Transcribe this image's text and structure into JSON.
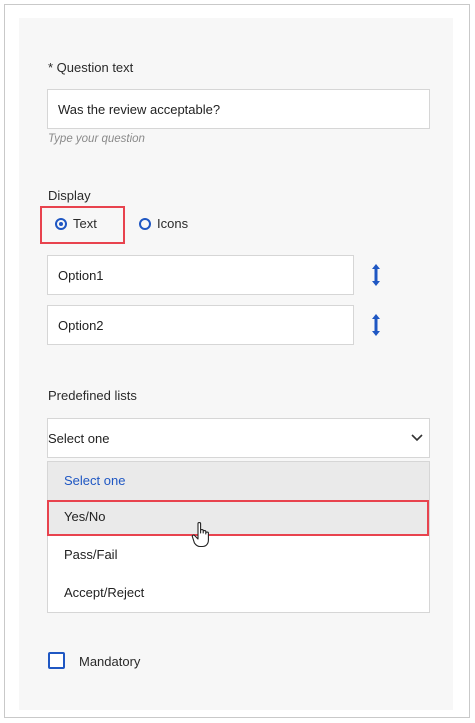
{
  "question": {
    "label": "* Question text",
    "value": "Was the review acceptable?",
    "hint": "Type your question"
  },
  "display": {
    "label": "Display",
    "options": [
      {
        "label": "Text",
        "selected": true
      },
      {
        "label": "Icons",
        "selected": false
      }
    ]
  },
  "options": [
    {
      "value": "Option1"
    },
    {
      "value": "Option2"
    }
  ],
  "predefined": {
    "label": "Predefined lists",
    "selected": "Select one",
    "items": [
      {
        "label": "Select one",
        "state": "current"
      },
      {
        "label": "Yes/No",
        "state": "hovered"
      },
      {
        "label": "Pass/Fail",
        "state": "normal"
      },
      {
        "label": "Accept/Reject",
        "state": "normal"
      }
    ]
  },
  "mandatory": {
    "label": "Mandatory",
    "checked": false
  },
  "colors": {
    "accent": "#1f57c3",
    "highlight": "#e8434e",
    "panel": "#f7f7f7"
  },
  "icons": [
    "radio-selected-icon",
    "radio-icon",
    "reorder-icon",
    "chevron-down-icon",
    "hand-cursor-icon",
    "checkbox-icon"
  ]
}
